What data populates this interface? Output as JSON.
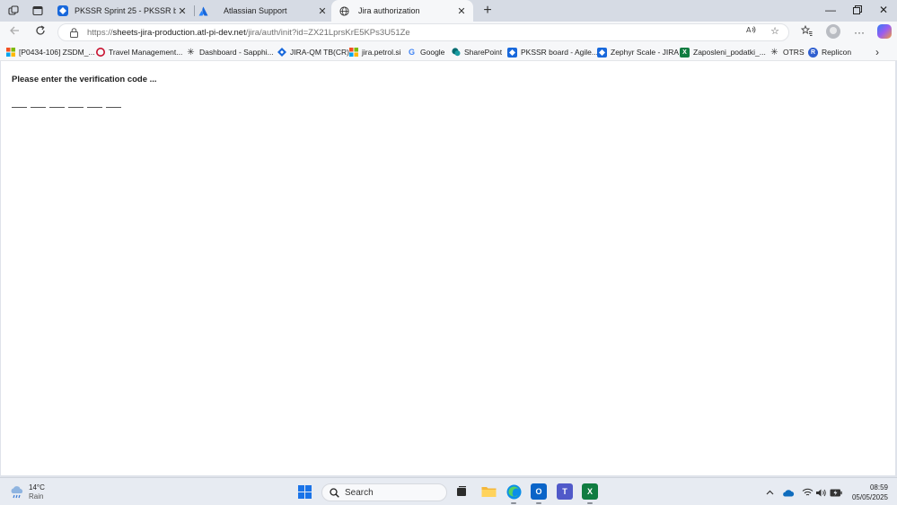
{
  "browser": {
    "tabs": [
      {
        "title": "PKSSR Sprint 25 - PKSSR board - ",
        "favicon": "jira-icon",
        "active": false
      },
      {
        "title": "Atlassian Support",
        "favicon": "atlassian-icon",
        "active": false
      },
      {
        "title": "Jira authorization",
        "favicon": "globe-icon",
        "active": true
      }
    ],
    "address": {
      "scheme": "https://",
      "host": "sheets-jira-production.atl-pi-dev.net",
      "path": "/jira/auth/init?id=ZX21LprsKrE5KPs3U51Ze"
    },
    "bookmarks": [
      {
        "label": "[P0434-106] ZSDM_...",
        "icon": "windows-logo-icon"
      },
      {
        "label": "Travel Management...",
        "icon": "travel-icon"
      },
      {
        "label": "Dashboard - Sapphi...",
        "icon": "sapphire-icon"
      },
      {
        "label": "JIRA-QM TB(CR)",
        "icon": "jira-icon"
      },
      {
        "label": "jira.petrol.si",
        "icon": "windows-logo-icon"
      },
      {
        "label": "Google",
        "icon": "google-icon"
      },
      {
        "label": "SharePoint",
        "icon": "sharepoint-icon"
      },
      {
        "label": "PKSSR board - Agile...",
        "icon": "jira-icon"
      },
      {
        "label": "Zephyr Scale - JIRA",
        "icon": "jira-icon"
      },
      {
        "label": "Zaposleni_podatki_...",
        "icon": "excel-icon"
      },
      {
        "label": "OTRS",
        "icon": "otrs-icon"
      },
      {
        "label": "Replicon",
        "icon": "replicon-icon"
      }
    ]
  },
  "page": {
    "prompt": "Please enter the verification code ...",
    "code_digits": [
      "",
      "",
      "",
      "",
      "",
      ""
    ]
  },
  "taskbar": {
    "weather": {
      "temp": "14°C",
      "condition": "Rain"
    },
    "search_label": "Search",
    "time": "08:59",
    "date": "05/05/2025"
  },
  "colors": {
    "jira_blue": "#1868db",
    "accent": "#1a73e8",
    "excel_green": "#107c41"
  }
}
